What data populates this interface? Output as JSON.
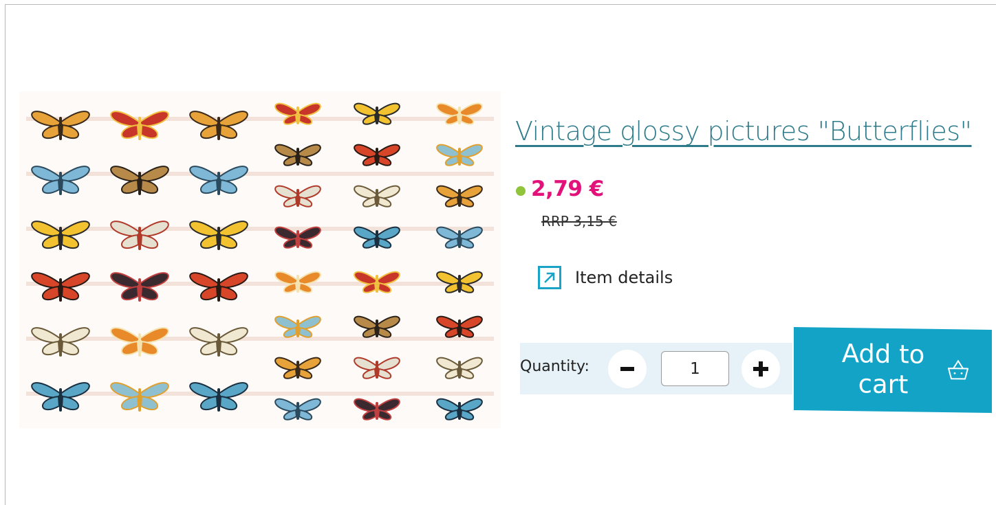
{
  "product": {
    "title": "Vintage glossy pictures \"Butterflies\"",
    "price": "2,79 €",
    "rrp": "RRP 3,15 €",
    "stock_color": "#8fc43b",
    "image_icon": "butterflies-sheet-image"
  },
  "details": {
    "label": "Item details",
    "icon": "external-link-arrow-icon"
  },
  "quantity": {
    "label": "Quantity:",
    "value": "1",
    "minus_icon": "minus-icon",
    "plus_icon": "plus-icon"
  },
  "cart": {
    "label": "Add to cart",
    "icon": "basket-icon"
  },
  "colors": {
    "accent": "#12a3c7",
    "title": "#2c7a8a",
    "price": "#e2127a",
    "quantity_bar": "#e6f2f7"
  }
}
